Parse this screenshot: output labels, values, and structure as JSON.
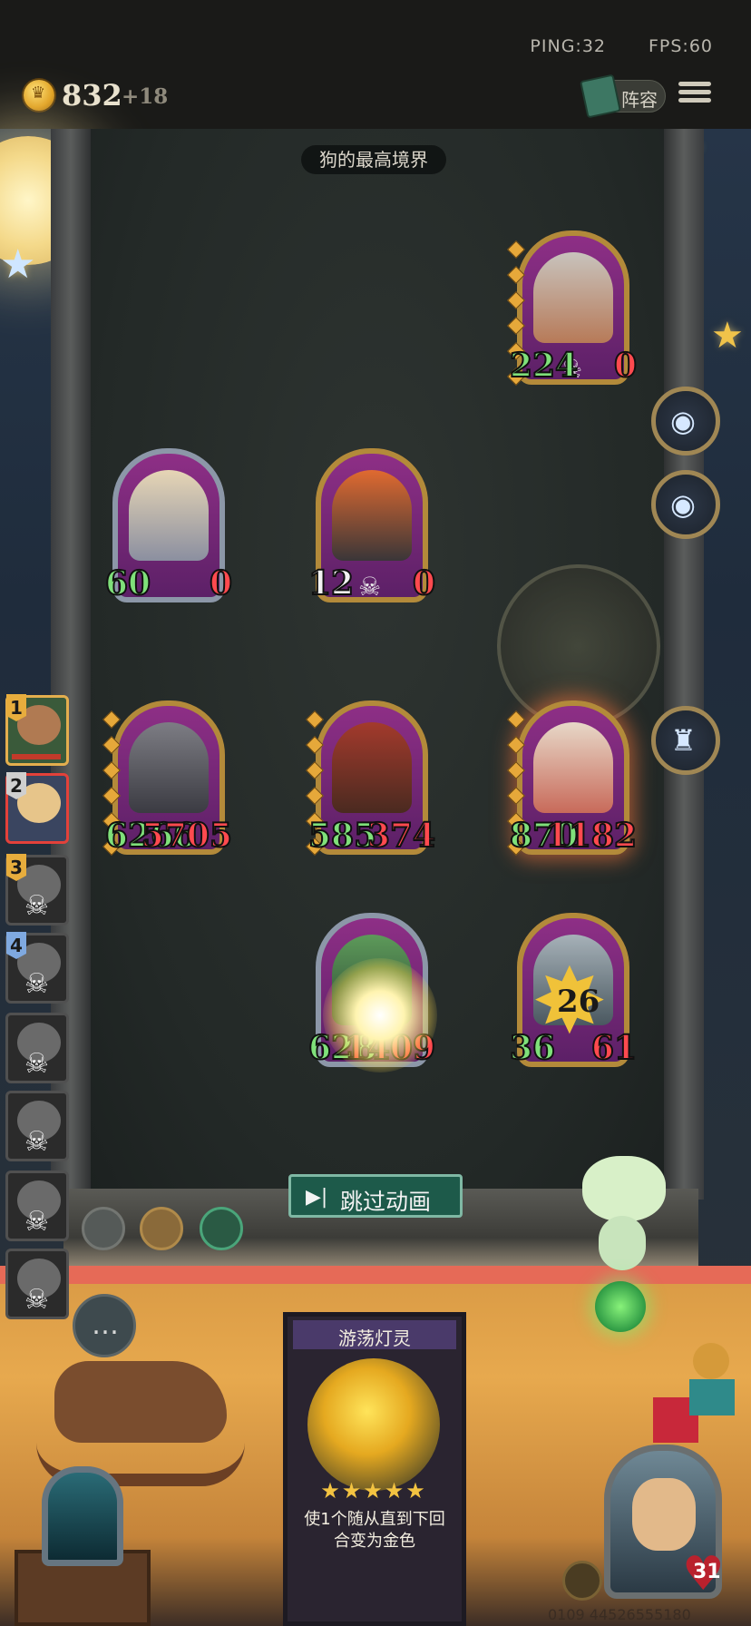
{
  "status": {
    "ping": "PING:32",
    "fps": "FPS:60"
  },
  "resources": {
    "gold": "832",
    "income": "+18",
    "coin_icon": "crown-coin-icon"
  },
  "header_buttons": {
    "lineup_label": "阵容",
    "menu_icon": "hamburger-menu-icon"
  },
  "encounter": {
    "title": "狗的最高境界"
  },
  "opponents": [
    {
      "rank": "1",
      "state": "alive"
    },
    {
      "rank": "2",
      "state": "self"
    },
    {
      "rank": "3",
      "state": "eliminated"
    },
    {
      "rank": "4",
      "state": "eliminated"
    },
    {
      "rank": "",
      "state": "eliminated"
    },
    {
      "rank": "",
      "state": "eliminated"
    },
    {
      "rank": "",
      "state": "eliminated"
    },
    {
      "rank": "",
      "state": "eliminated"
    }
  ],
  "board": {
    "enemy_minions": [
      {
        "attack": "224",
        "health": "0",
        "dead": true,
        "portrait": "helmet-dwarf"
      },
      {
        "attack": "60",
        "health": "0",
        "dead": false,
        "portrait": "armored-knight"
      },
      {
        "attack": "12",
        "health": "0",
        "dead": true,
        "portrait": "fire-dog"
      }
    ],
    "friendly_minions": [
      {
        "attack": "6266",
        "health": "5705",
        "portrait": "black-dragon"
      },
      {
        "attack": "585",
        "health": "374",
        "portrait": "red-dragon"
      },
      {
        "attack": "870",
        "health": "1182",
        "portrait": "old-inventor"
      },
      {
        "attack": "628",
        "health": "1409",
        "portrait": "goblin"
      },
      {
        "attack": "36",
        "health": "61",
        "portrait": "mummy"
      }
    ],
    "damage_popup": "26"
  },
  "controls": {
    "skip_label": "跳过动画",
    "skip_icon": "skip-forward-icon",
    "chat_icon": "chat-bubble-icon"
  },
  "spell_card": {
    "name": "游荡灯灵",
    "stars": "★★★★★",
    "description_line1": "使1个随从直到下回",
    "description_line2": "合变为金色"
  },
  "hero": {
    "health": "31"
  },
  "footer": {
    "version": "0109 44526555180"
  },
  "colors": {
    "attack": "#7fe07a",
    "health": "#ff4a4f",
    "gold_frame": "#b38a3a",
    "skip_bg": "#1d5a4a"
  }
}
